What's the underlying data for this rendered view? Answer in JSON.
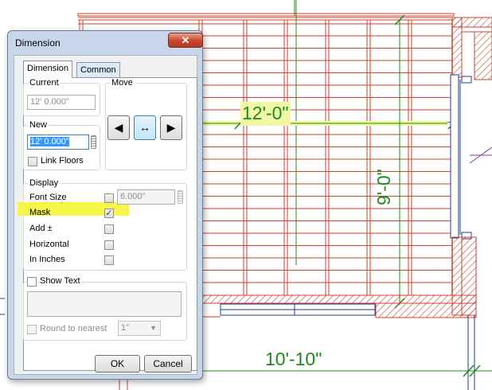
{
  "drawing": {
    "dim_top": "12'-0\"",
    "dim_right": "9'-0\"",
    "dim_bottom": "10'-10\""
  },
  "dialog": {
    "title": "Dimension",
    "close_glyph": "✕",
    "tabs": [
      "Dimension",
      "Common"
    ],
    "current": {
      "label": "Current",
      "value": "12' 0.000\""
    },
    "new": {
      "label": "New",
      "value": "12' 0.000\"",
      "link_floors_label": "Link Floors",
      "link_floors_checked": false
    },
    "move": {
      "label": "Move",
      "left_glyph": "◀",
      "center_glyph": "↔",
      "right_glyph": "▶"
    },
    "display": {
      "label": "Display",
      "font_size_label": "Font Size",
      "font_size_value": "6.000\"",
      "mask_label": "Mask",
      "mask_checked": true,
      "add_pm_label": "Add ±",
      "horizontal_label": "Horizontal",
      "in_inches_label": "In Inches"
    },
    "show_text_label": "Show Text",
    "round_label": "Round to nearest",
    "round_value": "1\"",
    "ok_label": "OK",
    "cancel_label": "Cancel"
  },
  "colors": {
    "framing": "#c8452e",
    "dimension": "#1c8a1c",
    "wall_hatch": "#c0392b",
    "highlight": "#f5f54a"
  }
}
